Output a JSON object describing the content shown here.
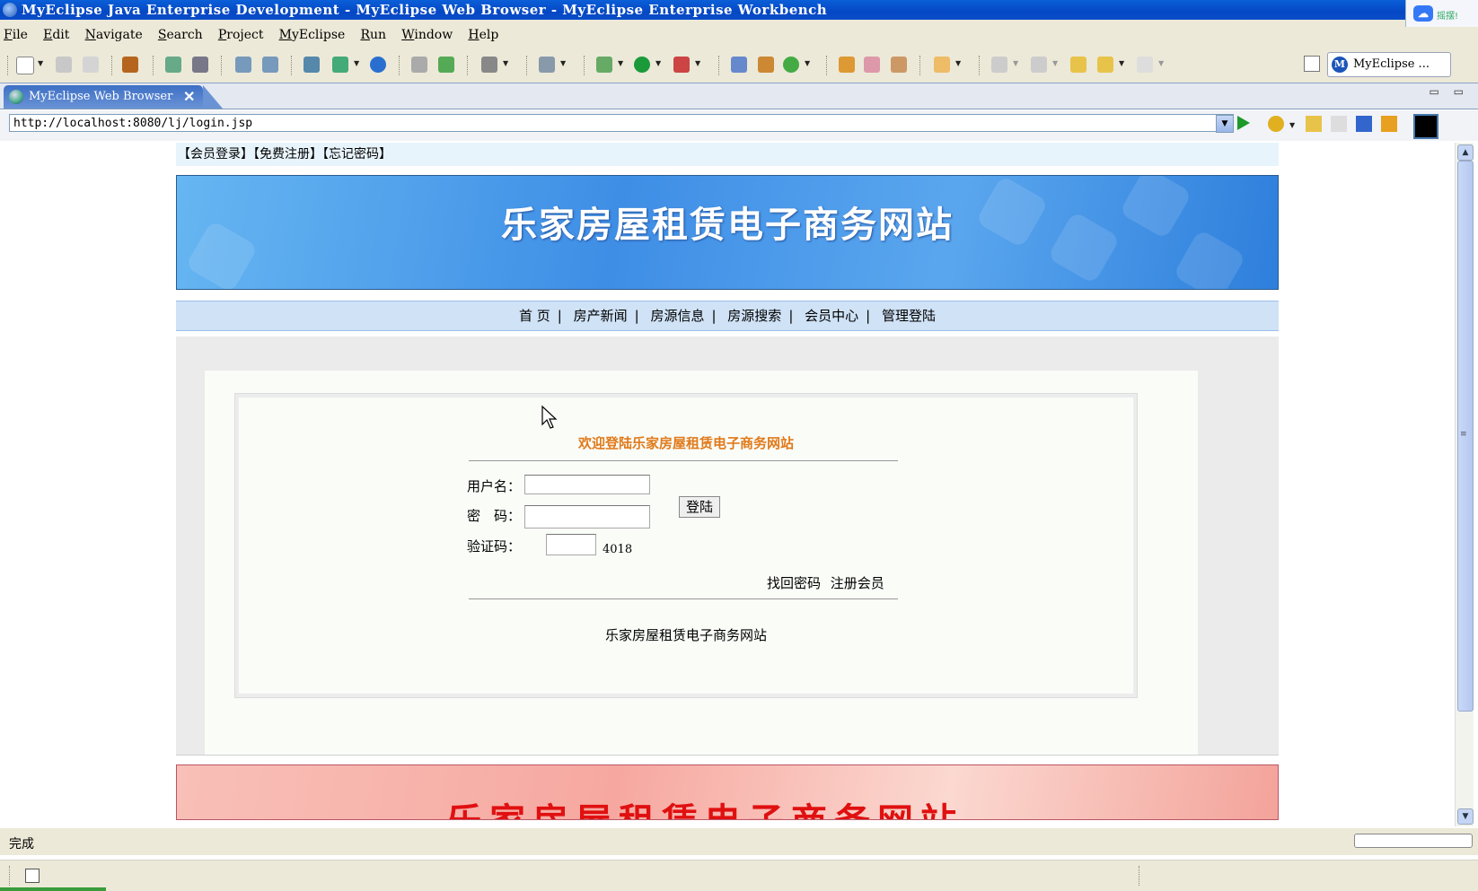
{
  "window": {
    "title": "MyEclipse Java Enterprise Development - MyEclipse Web Browser - MyEclipse Enterprise Workbench",
    "tray_text": "摇摆!"
  },
  "menu": [
    "File",
    "Edit",
    "Navigate",
    "Search",
    "Project",
    "MyEclipse",
    "Run",
    "Window",
    "Help"
  ],
  "perspective": {
    "label": "MyEclipse ..."
  },
  "editor_tab": {
    "label": "MyEclipse Web Browser",
    "close": "✕",
    "view_controls": "▭ ▭"
  },
  "browser": {
    "url": "http://localhost:8080/lj/login.jsp",
    "status": "完成"
  },
  "page": {
    "top_links": "【会员登录】【免费注册】【忘记密码】",
    "banner_title": "乐家房屋租赁电子商务网站",
    "nav": [
      "首 页",
      "房产新闻",
      "房源信息",
      "房源搜索",
      "会员中心",
      "管理登陆"
    ],
    "nav_separator": "|",
    "login": {
      "title": "欢迎登陆乐家房屋租赁电子商务网站",
      "username_label": "用户名：",
      "password_label": "密　码：",
      "captcha_label": "验证码：",
      "captcha_code": "4018",
      "submit_label": "登陆",
      "find_password": "找回密码",
      "register": "注册会员",
      "footer": "乐家房屋租赁电子商务网站"
    },
    "footer_banner_title": "乐家房屋租赁电子商务网站"
  },
  "colors": {
    "titlebar": "#0547c4",
    "login_title": "#e07a1a",
    "nav_bg": "#cfe2f6",
    "banner_blue": "#3e8ee6",
    "footer_banner_red": "#e01010"
  }
}
